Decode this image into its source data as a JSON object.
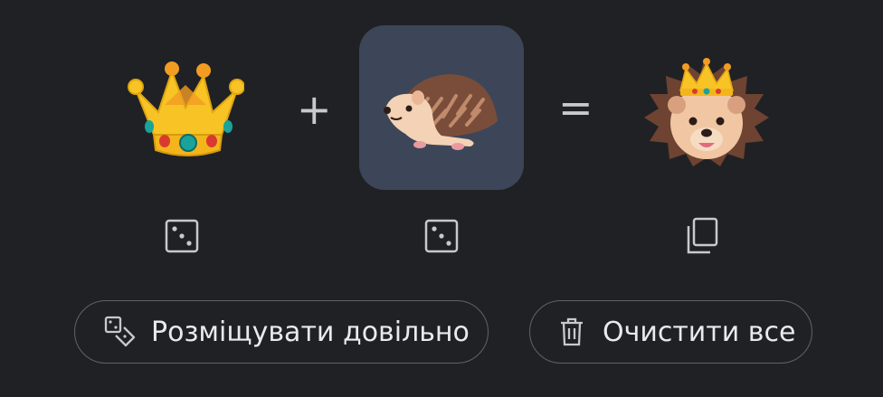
{
  "mixer": {
    "left_emoji": {
      "name": "crown",
      "selected": false
    },
    "operator_plus": "+",
    "middle_emoji": {
      "name": "hedgehog",
      "selected": true
    },
    "operator_equals": "=",
    "result_emoji": {
      "name": "crowned-hedgehog"
    }
  },
  "controls": {
    "left_randomize_icon": "dice-icon",
    "middle_randomize_icon": "dice-icon",
    "copy_icon": "copy-icon"
  },
  "actions": {
    "randomize_label": "Розміщувати довільно",
    "clear_label": "Очистити все"
  },
  "colors": {
    "background": "#202124",
    "selected_slot": "#3c4658",
    "outline": "#5f6368",
    "text": "#e8eaed"
  }
}
